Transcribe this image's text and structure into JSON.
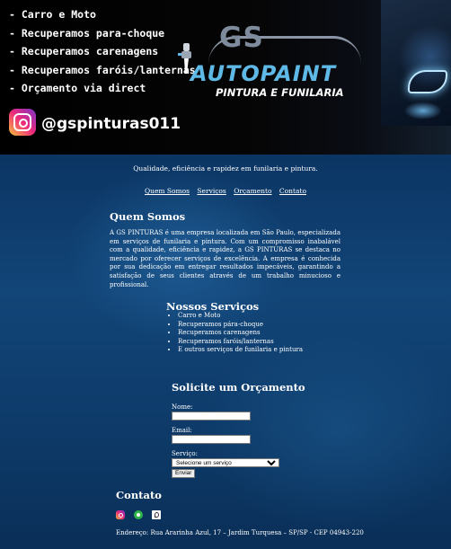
{
  "banner": {
    "features": [
      "- Carro e Moto",
      "- Recuperamos para-choque",
      "- Recuperamos carenagens",
      "- Recuperamos faróis/lanternas",
      "- Orçamento via direct"
    ],
    "logo": {
      "gs": "GS",
      "autopaint": "AUTOPAINT",
      "subtitle": "PINTURA E FUNILARIA"
    },
    "instagram_handle": "@gspinturas011"
  },
  "tagline": "Qualidade, eficiência e rapidez em funilaria e pintura.",
  "nav": {
    "items": [
      "Quem Somos",
      "Serviços",
      "Orçamento",
      "Contato"
    ]
  },
  "about": {
    "title": "Quem Somos",
    "text": "A GS PINTURAS é uma empresa localizada em São Paulo, especializada em serviços de funilaria e pintura. Com um compromisso inabalável com a qualidade, eficiência e rapidez, a GS PINTURAS se destaca no mercado por oferecer serviços de excelência. A empresa é conhecida por sua dedicação em entregar resultados impecáveis, garantindo a satisfação de seus clientes através de um trabalho minucioso e profissional."
  },
  "services": {
    "title": "Nossos Serviços",
    "items": [
      "Carro e Moto",
      "Recuperamos pára-choque",
      "Recuperamos carenagens",
      "Recuperamos faróis/lanternas",
      "E outros serviços de funilaria e pintura"
    ]
  },
  "quote": {
    "title": "Solicite um Orçamento",
    "name_label": "Nome:",
    "email_label": "Email:",
    "service_label": "Serviço:",
    "service_selected": "Selecione um serviço",
    "submit_label": "Enviar"
  },
  "contact": {
    "title": "Contato",
    "icons": [
      "instagram-icon",
      "whatsapp-icon",
      "map-icon"
    ],
    "address": "Endereço: Rua Ararinha Azul, 17 – Jardim Turquesa – SP/SP - CEP 04943-220"
  },
  "colors": {
    "background": "#0d3a68",
    "banner": "#000000",
    "logo_blue": "#5fb9e6",
    "text": "#ffffff"
  }
}
